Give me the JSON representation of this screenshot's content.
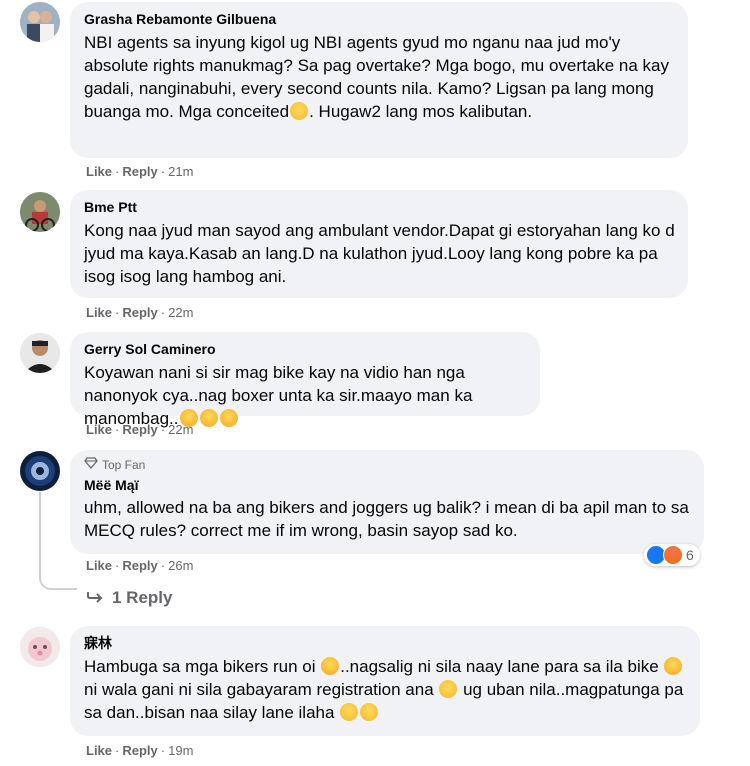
{
  "comments": [
    {
      "author": "Grasha Rebamonte Gilbuena",
      "text_parts": [
        "NBI agents sa inyung kigol ug NBI agents gyud mo nganu naa jud mo'y absolute rights manukmag? Sa pag overtake? Mga bogo, mu overtake na kay gadali, nanginabuhi, every second counts nila. Kamo? Ligsan pa lang mong buanga mo. Mga conceited",
        ". Hugaw2 lang mos kalibutan."
      ],
      "like": "Like",
      "reply": "Reply",
      "time": "21m"
    },
    {
      "author": "Bme Ptt",
      "text": "Kong naa jyud man sayod ang ambulant vendor.Dapat gi estoryahan lang ko d jyud ma kaya.Kasab an lang.D na kulathon jyud.Looy lang kong pobre ka pa isog isog lang hambog ani.",
      "like": "Like",
      "reply": "Reply",
      "time": "22m"
    },
    {
      "author": "Gerry Sol Caminero",
      "text": "Koyawan nani si sir mag bike kay na vidio han nga nanonyok cya..nag boxer unta ka sir.maayo man ka manombag..",
      "like": "Like",
      "reply": "Reply",
      "time": "22m"
    },
    {
      "badge": "Top Fan",
      "author": "Mёё Mąï",
      "text": "uhm, allowed na ba ang bikers and joggers ug balik? i mean di ba apil man to sa MECQ rules? correct me if im wrong, basin sayop sad ko.",
      "like": "Like",
      "reply": "Reply",
      "time": "26m",
      "reaction_count": "6",
      "replies_label": "1 Reply"
    },
    {
      "author": "寐林",
      "text_parts": [
        "Hambuga sa mga bikers run oi ",
        "..nagsalig ni sila naay lane para sa ila bike ",
        " ni wala gani ni sila gabayaram registration ana ",
        " ug uban nila..magpatunga pa sa dan..bisan naa silay lane ilaha "
      ],
      "like": "Like",
      "reply": "Reply",
      "time": "19m"
    }
  ],
  "colors": {
    "bubble": "#f0f2f5",
    "meta": "#65676b",
    "like_blue": "#1877f2",
    "angry": "#f7714c"
  },
  "icons": [
    "diamond-icon",
    "reply-arrow-icon",
    "like-reaction-icon",
    "angry-reaction-icon",
    "laughing-emoji-icon",
    "rolling-eyes-emoji-icon",
    "flushed-emoji-icon"
  ]
}
